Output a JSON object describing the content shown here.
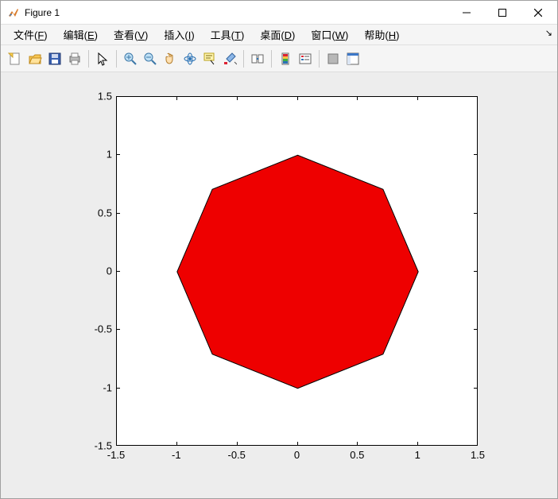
{
  "window": {
    "title": "Figure 1",
    "minimize": "–",
    "maximize": "▢",
    "close": "✕"
  },
  "menu": {
    "file": "文件(F)",
    "edit": "编辑(E)",
    "view": "查看(V)",
    "insert": "插入(I)",
    "tools": "工具(T)",
    "desktop": "桌面(D)",
    "window": "窗口(W)",
    "help": "帮助(H)"
  },
  "toolbar_icons": {
    "new": "new-figure-icon",
    "open": "open-file-icon",
    "save": "save-icon",
    "print": "print-icon",
    "pointer": "pointer-icon",
    "zoomin": "zoom-in-icon",
    "zoomout": "zoom-out-icon",
    "pan": "pan-icon",
    "rotate": "rotate3d-icon",
    "datacursor": "data-cursor-icon",
    "brush": "brush-icon",
    "link": "link-plot-icon",
    "colorbar": "colorbar-icon",
    "legend": "legend-icon",
    "hide": "hide-plot-tools-icon",
    "show": "show-plot-tools-icon"
  },
  "colors": {
    "fill": "#ee0000",
    "edge": "#000000"
  },
  "chart_data": {
    "type": "area",
    "title": "",
    "xlabel": "",
    "ylabel": "",
    "xlim": [
      -1.5,
      1.5
    ],
    "ylim": [
      -1.5,
      1.5
    ],
    "xticks": [
      -1.5,
      -1,
      -0.5,
      0,
      0.5,
      1,
      1.5
    ],
    "yticks": [
      -1.5,
      -1,
      -0.5,
      0,
      0.5,
      1,
      1.5
    ],
    "series": [
      {
        "name": "octagon",
        "x": [
          1.0,
          0.7071,
          0.0,
          -0.7071,
          -1.0,
          -0.7071,
          0.0,
          0.7071
        ],
        "y": [
          0.0,
          0.7071,
          1.0,
          0.7071,
          0.0,
          -0.7071,
          -1.0,
          -0.7071
        ],
        "fill": "#ee0000",
        "edge": "#000000"
      }
    ]
  }
}
